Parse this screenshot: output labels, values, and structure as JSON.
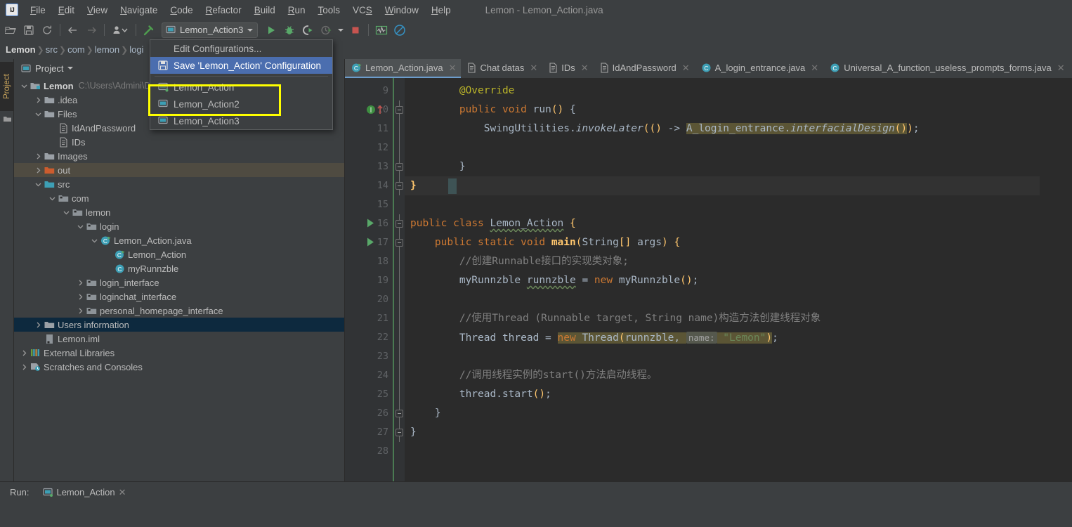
{
  "window": {
    "title": "Lemon - Lemon_Action.java",
    "logo_text": "IJ"
  },
  "menubar": {
    "items": [
      {
        "label": "File",
        "mnemonic": "F"
      },
      {
        "label": "Edit",
        "mnemonic": "E"
      },
      {
        "label": "View",
        "mnemonic": "V"
      },
      {
        "label": "Navigate",
        "mnemonic": "N"
      },
      {
        "label": "Code",
        "mnemonic": "C"
      },
      {
        "label": "Refactor",
        "mnemonic": "R"
      },
      {
        "label": "Build",
        "mnemonic": "B"
      },
      {
        "label": "Run",
        "mnemonic": "R"
      },
      {
        "label": "Tools",
        "mnemonic": "T"
      },
      {
        "label": "VCS",
        "mnemonic": "S"
      },
      {
        "label": "Window",
        "mnemonic": "W"
      },
      {
        "label": "Help",
        "mnemonic": "H"
      }
    ]
  },
  "toolbar": {
    "run_configuration": "Lemon_Action3",
    "buttons": [
      {
        "name": "open-project-icon",
        "title": "Open"
      },
      {
        "name": "save-all-icon",
        "title": "Save All"
      },
      {
        "name": "sync-icon",
        "title": "Synchronize"
      },
      {
        "name": "back-arrow-icon",
        "title": "Back"
      },
      {
        "name": "forward-arrow-icon",
        "title": "Forward"
      },
      {
        "name": "update-project-icon",
        "title": "Update Project"
      },
      {
        "name": "build-hammer-icon",
        "title": "Build Project"
      },
      {
        "name": "run-icon",
        "title": "Run"
      },
      {
        "name": "debug-icon",
        "title": "Debug"
      },
      {
        "name": "run-with-coverage-icon",
        "title": "Run with Coverage"
      },
      {
        "name": "profiler-icon",
        "title": "Profiler"
      },
      {
        "name": "stop-icon",
        "title": "Stop"
      },
      {
        "name": "activity-monitor-icon",
        "title": "Activity Monitor"
      },
      {
        "name": "no-entry-icon",
        "title": "Disabled"
      }
    ]
  },
  "breadcrumb": {
    "items": [
      "Lemon",
      "src",
      "com",
      "lemon",
      "logi"
    ]
  },
  "run_config_popup": {
    "edit_configurations": "Edit Configurations...",
    "save_configuration": "Save 'Lemon_Action' Configuration",
    "entries": [
      {
        "label": "Lemon_Action",
        "running": true
      },
      {
        "label": "Lemon_Action2",
        "running": false
      },
      {
        "label": "Lemon_Action3",
        "running": false
      }
    ]
  },
  "project_panel": {
    "title": "Project",
    "vertical_tab": "Project",
    "tree": [
      {
        "depth": 0,
        "label": "Lemon",
        "sub": "C:\\Users\\Admini\\D",
        "icon": "module-icon",
        "arrow": "down",
        "bold": true,
        "state": "none"
      },
      {
        "depth": 1,
        "label": ".idea",
        "sub": "",
        "icon": "folder-grey-icon",
        "arrow": "right",
        "bold": false,
        "state": "none"
      },
      {
        "depth": 1,
        "label": "Files",
        "sub": "",
        "icon": "folder-grey-icon",
        "arrow": "down",
        "bold": false,
        "state": "none"
      },
      {
        "depth": 2,
        "label": "IdAndPassword",
        "sub": "",
        "icon": "text-file-icon",
        "arrow": "none",
        "bold": false,
        "state": "none"
      },
      {
        "depth": 2,
        "label": "IDs",
        "sub": "",
        "icon": "text-file-icon",
        "arrow": "none",
        "bold": false,
        "state": "none"
      },
      {
        "depth": 1,
        "label": "Images",
        "sub": "",
        "icon": "folder-grey-icon",
        "arrow": "right",
        "bold": false,
        "state": "none"
      },
      {
        "depth": 1,
        "label": "out",
        "sub": "",
        "icon": "folder-orange-icon",
        "arrow": "right",
        "bold": false,
        "state": "brown"
      },
      {
        "depth": 1,
        "label": "src",
        "sub": "",
        "icon": "folder-blue-icon",
        "arrow": "down",
        "bold": false,
        "state": "none"
      },
      {
        "depth": 2,
        "label": "com",
        "sub": "",
        "icon": "package-icon",
        "arrow": "down",
        "bold": false,
        "state": "none"
      },
      {
        "depth": 3,
        "label": "lemon",
        "sub": "",
        "icon": "package-icon",
        "arrow": "down",
        "bold": false,
        "state": "none"
      },
      {
        "depth": 4,
        "label": "login",
        "sub": "",
        "icon": "package-icon",
        "arrow": "down",
        "bold": false,
        "state": "none"
      },
      {
        "depth": 5,
        "label": "Lemon_Action.java",
        "sub": "",
        "icon": "java-run-class-icon",
        "arrow": "down",
        "bold": false,
        "state": "none"
      },
      {
        "depth": 6,
        "label": "Lemon_Action",
        "sub": "",
        "icon": "java-run-class-icon",
        "arrow": "none",
        "bold": false,
        "state": "none"
      },
      {
        "depth": 6,
        "label": "myRunnzble",
        "sub": "",
        "icon": "java-class-icon",
        "arrow": "none",
        "bold": false,
        "state": "none"
      },
      {
        "depth": 4,
        "label": "login_interface",
        "sub": "",
        "icon": "package-icon",
        "arrow": "right",
        "bold": false,
        "state": "none"
      },
      {
        "depth": 4,
        "label": "loginchat_interface",
        "sub": "",
        "icon": "package-icon",
        "arrow": "right",
        "bold": false,
        "state": "none"
      },
      {
        "depth": 4,
        "label": "personal_homepage_interface",
        "sub": "",
        "icon": "package-icon",
        "arrow": "right",
        "bold": false,
        "state": "none"
      },
      {
        "depth": 1,
        "label": "Users information",
        "sub": "",
        "icon": "folder-grey-icon",
        "arrow": "right",
        "bold": false,
        "state": "blue"
      },
      {
        "depth": 1,
        "label": "Lemon.iml",
        "sub": "",
        "icon": "iml-file-icon",
        "arrow": "none",
        "bold": false,
        "state": "none"
      },
      {
        "depth": 0,
        "label": "External Libraries",
        "sub": "",
        "icon": "libraries-icon",
        "arrow": "right",
        "bold": false,
        "state": "none"
      },
      {
        "depth": 0,
        "label": "Scratches and Consoles",
        "sub": "",
        "icon": "scratches-icon",
        "arrow": "right",
        "bold": false,
        "state": "none"
      }
    ]
  },
  "editor_tabs": [
    {
      "label": "Lemon_Action.java",
      "icon": "java-run-class-icon",
      "active": true
    },
    {
      "label": "Chat datas",
      "icon": "text-file-icon",
      "active": false
    },
    {
      "label": "IDs",
      "icon": "text-file-icon",
      "active": false
    },
    {
      "label": "IdAndPassword",
      "icon": "text-file-icon",
      "active": false
    },
    {
      "label": "A_login_entrance.java",
      "icon": "java-class-icon",
      "active": false
    },
    {
      "label": "Universal_A_function_useless_prompts_forms.java",
      "icon": "java-class-icon",
      "active": false
    }
  ],
  "editor": {
    "first_line": 9,
    "lines": [
      {
        "n": 9,
        "segs": [
          {
            "t": "        ",
            "c": "pln"
          },
          {
            "t": "@Override",
            "c": "ann"
          }
        ]
      },
      {
        "n": 10,
        "segs": [
          {
            "t": "        ",
            "c": "pln"
          },
          {
            "t": "public",
            "c": "k"
          },
          {
            "t": " ",
            "c": "pln"
          },
          {
            "t": "void",
            "c": "k"
          },
          {
            "t": " run",
            "c": "pln"
          },
          {
            "t": "()",
            "c": "sq"
          },
          {
            "t": " ",
            "c": "pln"
          },
          {
            "t": "{",
            "c": "pln"
          }
        ]
      },
      {
        "n": 11,
        "segs": [
          {
            "t": "            SwingUtilities.",
            "c": "pln"
          },
          {
            "t": "invokeLater",
            "c": "mth"
          },
          {
            "t": "((",
            "c": "sq"
          },
          {
            "t": ")",
            "c": "sq"
          },
          {
            "t": " -> ",
            "c": "pln"
          },
          {
            "t": "A_login_entrance.",
            "c": "pln hl"
          },
          {
            "t": "interfacialDesign",
            "c": "mth hl"
          },
          {
            "t": "()",
            "c": "sq hl"
          },
          {
            "t": ")",
            "c": "sq"
          },
          {
            "t": ";",
            "c": "pln"
          }
        ]
      },
      {
        "n": 12,
        "segs": []
      },
      {
        "n": 13,
        "segs": [
          {
            "t": "        }",
            "c": "pln"
          }
        ]
      },
      {
        "n": 14,
        "segs": [
          {
            "t": "}",
            "c": "yb"
          }
        ]
      },
      {
        "n": 15,
        "segs": []
      },
      {
        "n": 16,
        "segs": [
          {
            "t": "public",
            "c": "k"
          },
          {
            "t": " ",
            "c": "pln"
          },
          {
            "t": "class",
            "c": "k"
          },
          {
            "t": " ",
            "c": "pln"
          },
          {
            "t": "Lemon_Action",
            "c": "pln wavy"
          },
          {
            "t": " ",
            "c": "pln"
          },
          {
            "t": "{",
            "c": "sq"
          }
        ]
      },
      {
        "n": 17,
        "segs": [
          {
            "t": "    ",
            "c": "pln"
          },
          {
            "t": "public",
            "c": "k"
          },
          {
            "t": " ",
            "c": "pln"
          },
          {
            "t": "static",
            "c": "k"
          },
          {
            "t": " ",
            "c": "pln"
          },
          {
            "t": "void",
            "c": "k"
          },
          {
            "t": " ",
            "c": "pln"
          },
          {
            "t": "main",
            "c": "yb"
          },
          {
            "t": "(",
            "c": "sq"
          },
          {
            "t": "String",
            "c": "pln"
          },
          {
            "t": "[]",
            "c": "sq"
          },
          {
            "t": " args",
            "c": "pln"
          },
          {
            "t": ")",
            "c": "sq"
          },
          {
            "t": " ",
            "c": "pln"
          },
          {
            "t": "{",
            "c": "sq"
          }
        ]
      },
      {
        "n": 18,
        "segs": [
          {
            "t": "        //创建Runnable接口的实现类对象;",
            "c": "cmt"
          }
        ]
      },
      {
        "n": 19,
        "segs": [
          {
            "t": "        myRunnzble ",
            "c": "pln"
          },
          {
            "t": "runnzble",
            "c": "pln wavy"
          },
          {
            "t": " = ",
            "c": "pln"
          },
          {
            "t": "new",
            "c": "k"
          },
          {
            "t": " myRunnzble",
            "c": "pln"
          },
          {
            "t": "()",
            "c": "sq"
          },
          {
            "t": ";",
            "c": "pln"
          }
        ]
      },
      {
        "n": 20,
        "segs": []
      },
      {
        "n": 21,
        "segs": [
          {
            "t": "        //使用Thread (Runnable target, String name)构造方法创建线程对象",
            "c": "cmt"
          }
        ]
      },
      {
        "n": 22,
        "segs": [
          {
            "t": "        Thread thread = ",
            "c": "pln"
          },
          {
            "t": "new",
            "c": "k hl"
          },
          {
            "t": " Thread",
            "c": "pln hl"
          },
          {
            "t": "(",
            "c": "sq hl"
          },
          {
            "t": "runnzble",
            "c": "pln hl"
          },
          {
            "t": ", ",
            "c": "pln hl"
          },
          {
            "t": "name:",
            "c": "hint"
          },
          {
            "t": " ",
            "c": "pln hl"
          },
          {
            "t": "\"Lemon\"",
            "c": "str hl"
          },
          {
            "t": ")",
            "c": "sq hl"
          },
          {
            "t": ";",
            "c": "pln"
          }
        ]
      },
      {
        "n": 23,
        "segs": []
      },
      {
        "n": 24,
        "segs": [
          {
            "t": "        //调用线程实例的start()方法启动线程。",
            "c": "cmt"
          }
        ]
      },
      {
        "n": 25,
        "segs": [
          {
            "t": "        thread.",
            "c": "pln"
          },
          {
            "t": "start",
            "c": "pln"
          },
          {
            "t": "()",
            "c": "sq"
          },
          {
            "t": ";",
            "c": "pln"
          }
        ]
      },
      {
        "n": 26,
        "segs": [
          {
            "t": "    }",
            "c": "pln"
          }
        ]
      },
      {
        "n": 27,
        "segs": [
          {
            "t": "}",
            "c": "pln"
          }
        ]
      },
      {
        "n": 28,
        "segs": []
      }
    ],
    "gutter_markers": [
      {
        "line": 10,
        "kind": "implementing-method-icon",
        "glyph": "I"
      },
      {
        "line": 16,
        "kind": "run-gutter-icon",
        "glyph": "▶"
      },
      {
        "line": 17,
        "kind": "run-gutter-icon",
        "glyph": "▶"
      }
    ]
  },
  "statusbar": {
    "run_label": "Run:",
    "run_tab": "Lemon_Action"
  },
  "colors": {
    "accent_blue": "#4b6eaf",
    "highlight_yellow": "#ffff00",
    "editor_bg": "#2b2b2b",
    "panel_bg": "#3c3f41",
    "selection_brown": "#4f4b41",
    "selection_blue": "#0d293e",
    "keyword_orange": "#cc7832",
    "string_green": "#6a8759",
    "method_yellow": "#ffc66d",
    "comment_grey": "#808080"
  }
}
